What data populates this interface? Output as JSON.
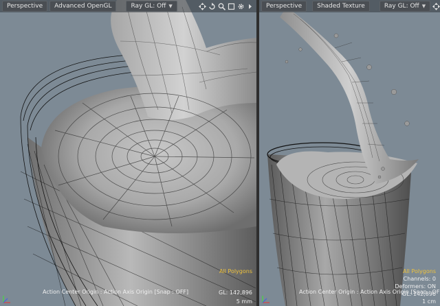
{
  "left_viewport": {
    "view_mode": "Perspective",
    "shading": "Advanced OpenGL",
    "ray_gl": "Ray GL: Off",
    "info": {
      "selection": "All Polygons",
      "gl": "GL: 142,896",
      "scale": "5 mm"
    },
    "status": "Action Center Origin : Action Axis Origin  [Snap : OFF]"
  },
  "right_viewport": {
    "view_mode": "Perspective",
    "shading": "Shaded Texture",
    "ray_gl": "Ray GL: Off",
    "info": {
      "selection": "All Polygons",
      "channels": "Channels: 0",
      "deformers": "Deformers: ON",
      "gl": "GL: 142,896",
      "scale": "1 cm"
    },
    "status": "Action Center Origin : Action Axis Origin  [Snap : OFF]"
  },
  "icons": [
    "move-view-icon",
    "rotate-view-icon",
    "zoom-view-icon",
    "maximize-icon",
    "settings-gear-icon",
    "expand-arrow-icon",
    "axis-gizmo-icon"
  ],
  "colors": {
    "viewport_bg": "#7d8a95",
    "header_bg": "#4a4e53",
    "selection_text": "#f0c33c"
  }
}
